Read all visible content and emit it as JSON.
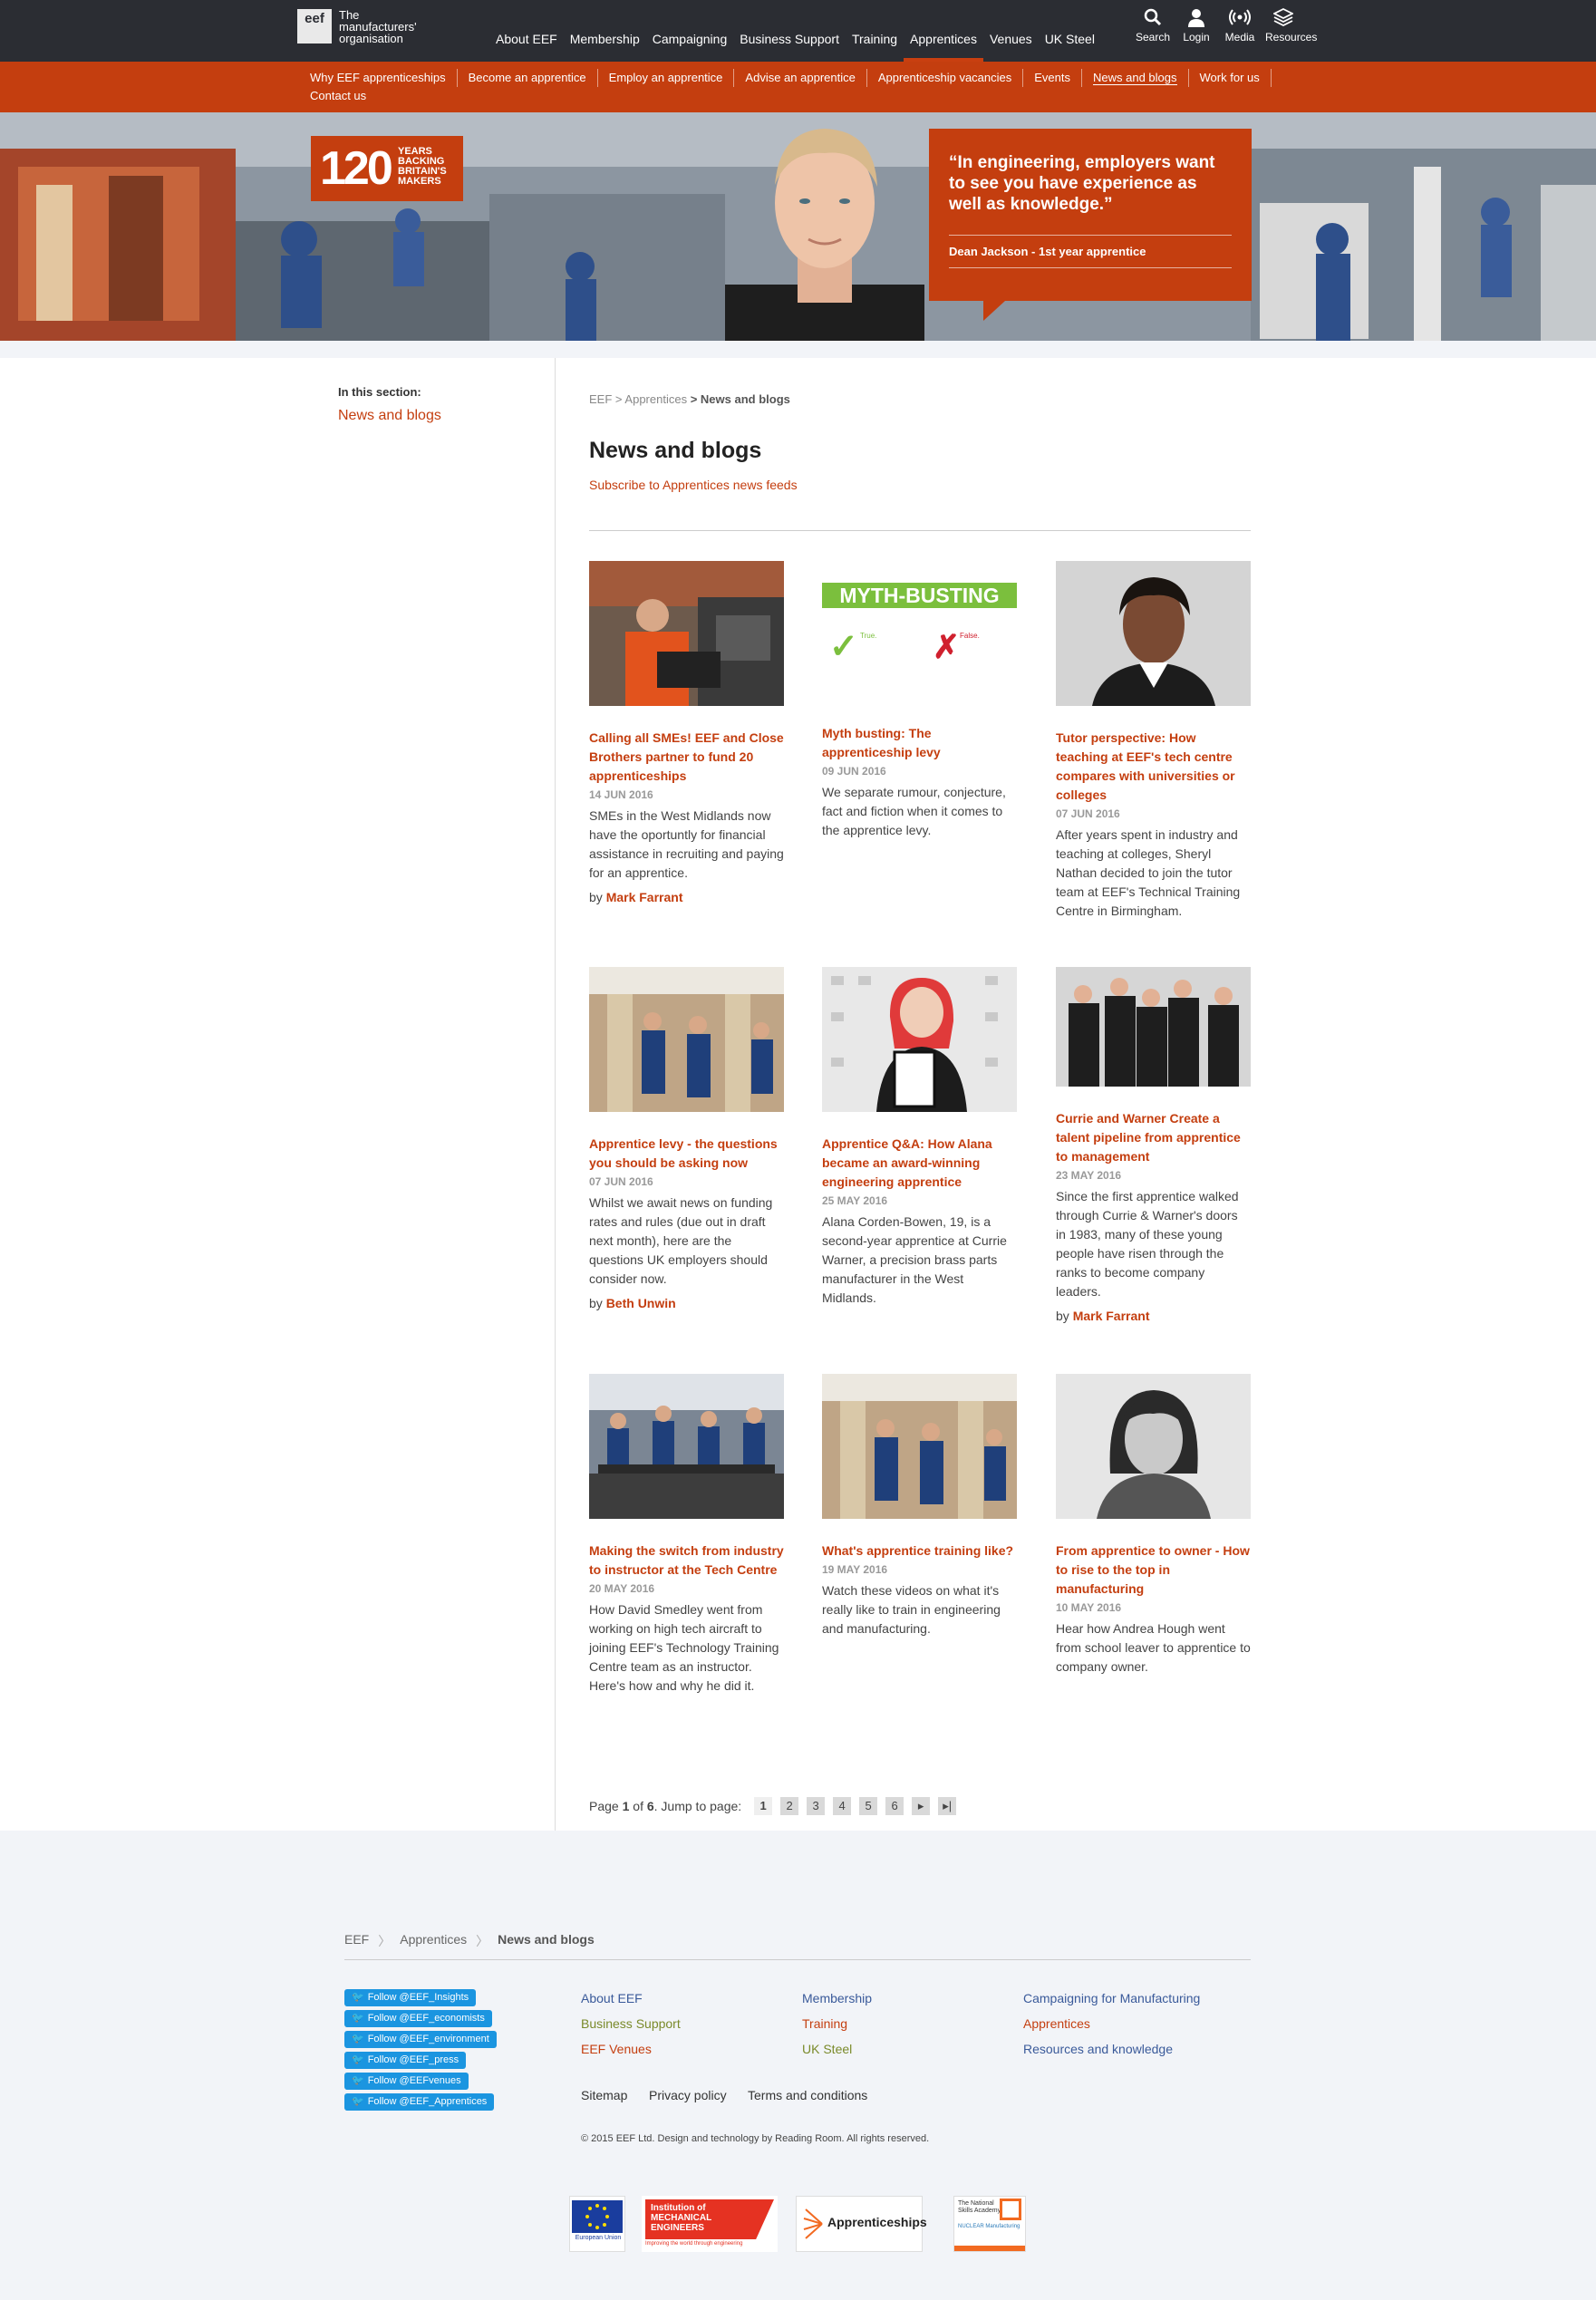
{
  "header": {
    "logo_mark": "eef",
    "logo_line1": "The",
    "logo_line2": "manufacturers'",
    "logo_line3": "organisation",
    "nav": [
      "About EEF",
      "Membership",
      "Campaigning",
      "Business Support",
      "Training",
      "Apprentices",
      "Venues",
      "UK Steel"
    ],
    "active_nav": "Apprentices",
    "utility": [
      {
        "label": "Search",
        "icon": "search-icon"
      },
      {
        "label": "Login",
        "icon": "user-icon"
      },
      {
        "label": "Media",
        "icon": "broadcast-icon"
      },
      {
        "label": "Resources",
        "icon": "layers-icon"
      }
    ]
  },
  "subnav": {
    "items": [
      "Why EEF apprenticeships",
      "Become an apprentice",
      "Employ an apprentice",
      "Advise an apprentice",
      "Apprenticeship vacancies",
      "Events",
      "News and blogs",
      "Work for us",
      "Contact us"
    ],
    "active": "News and blogs"
  },
  "hero": {
    "badge_number": "120",
    "badge_l1": "YEARS",
    "badge_l2": "BACKING",
    "badge_l3": "BRITAIN'S",
    "badge_l4": "MAKERS",
    "quote": "“In engineering, employers want to see you have experience as well as knowledge.”",
    "quote_author": "Dean Jackson - 1st year apprentice"
  },
  "sidebar": {
    "heading": "In this section:",
    "link": "News and blogs"
  },
  "breadcrumb": {
    "root": "EEF",
    "parent": "Apprentices",
    "current": "News and blogs",
    "sep": ">"
  },
  "page": {
    "title": "News and blogs",
    "subscribe": "Subscribe to Apprentices news feeds"
  },
  "articles": [
    {
      "title": "Calling all SMEs! EEF and Close Brothers partner to fund 20 apprenticeships",
      "date": "14 JUN 2016",
      "excerpt": "SMEs in the West Midlands now have the oportuntly for financial assistance in recruiting and paying for an apprentice.",
      "author": "Mark Farrant"
    },
    {
      "title": "Myth busting: The apprenticeship levy",
      "date": "09 JUN 2016",
      "excerpt": "We separate rumour, conjecture, fact and fiction when it comes to the apprentice levy.",
      "author": "",
      "img_heading": "MYTH-BUSTING",
      "img_true": "True.",
      "img_false": "False."
    },
    {
      "title": "Tutor perspective: How teaching at EEF's tech centre compares with universities or colleges",
      "date": "07 JUN 2016",
      "excerpt": "After years spent in industry and teaching at colleges, Sheryl Nathan decided to join the tutor team at EEF's Technical Training Centre in Birmingham.",
      "author": ""
    },
    {
      "title": "Apprentice levy - the questions you should be asking now",
      "date": "07 JUN 2016",
      "excerpt": "Whilst we await news on funding rates and rules (due out in draft next month), here are the questions UK employers should consider now.",
      "author": "Beth Unwin"
    },
    {
      "title": "Apprentice Q&A: How Alana became an award-winning engineering apprentice",
      "date": "25 MAY 2016",
      "excerpt": "Alana Corden-Bowen, 19, is a second-year apprentice at Currie Warner, a precision brass parts manufacturer in the West Midlands.",
      "author": ""
    },
    {
      "title": "Currie and Warner Create a talent pipeline from apprentice to management",
      "date": "23 MAY 2016",
      "excerpt": "Since the first apprentice walked through Currie & Warner's doors in 1983, many of these young people have risen through the ranks to become company leaders.",
      "author": "Mark Farrant"
    },
    {
      "title": "Making the switch from industry to instructor at the Tech Centre",
      "date": "20 MAY 2016",
      "excerpt": "How David Smedley went from working on high tech aircraft to joining EEF's Technology Training Centre team as an instructor. Here's how and why he did it.",
      "author": ""
    },
    {
      "title": "What's apprentice training like?",
      "date": "19 MAY 2016",
      "excerpt": "Watch these videos on what it's really like to train in engineering and manufacturing.",
      "author": ""
    },
    {
      "title": "From apprentice to owner - How to rise to the top in manufacturing",
      "date": "10 MAY 2016",
      "excerpt": "Hear how Andrea Hough went from school leaver to apprentice to company owner.",
      "author": ""
    }
  ],
  "by_prefix": "by",
  "pager": {
    "prefix": "Page",
    "current": "1",
    "of": "of",
    "total": "6",
    "jump": ". Jump to page:",
    "pages": [
      "1",
      "2",
      "3",
      "4",
      "5",
      "6"
    ],
    "next": "▸",
    "last": "▸|"
  },
  "footer": {
    "crumbs": [
      "EEF",
      "Apprentices",
      "News and blogs"
    ],
    "twitter": [
      "Follow @EEF_Insights",
      "Follow @EEF_economists",
      "Follow @EEF_environment",
      "Follow @EEF_press",
      "Follow @EEFvenues",
      "Follow @EEF_Apprentices"
    ],
    "col1": [
      "About EEF",
      "Business Support",
      "EEF Venues"
    ],
    "col2": [
      "Membership",
      "Training",
      "UK Steel"
    ],
    "col3": [
      "Campaigning for Manufacturing",
      "Apprentices",
      "Resources and knowledge"
    ],
    "bottom_links": [
      "Sitemap",
      "Privacy policy",
      "Terms and conditions"
    ],
    "copyright": "© 2015 EEF Ltd. Design and technology by Reading Room. All rights reserved.",
    "partners": [
      {
        "name": "European Union",
        "sub": "European Social Fund"
      },
      {
        "name": "Institution of MECHANICAL ENGINEERS",
        "sub": "Improving the world through engineering"
      },
      {
        "name": "Apprenticeships"
      },
      {
        "name": "The National Skills Academy",
        "sub": "NUCLEAR Manufacturing"
      }
    ],
    "colors": {
      "col1": [
        "#3a5a9a",
        "#7a8a2a",
        "#c43e0f"
      ],
      "col2": [
        "#3a5a9a",
        "#c43e0f",
        "#7a8a2a"
      ],
      "col3": [
        "#3a5a9a",
        "#c43e0f",
        "#3a5a9a"
      ]
    }
  },
  "colors": {
    "accent": "#c43e0f",
    "topbar": "#2b2d33",
    "twitter": "#1b95e0"
  }
}
